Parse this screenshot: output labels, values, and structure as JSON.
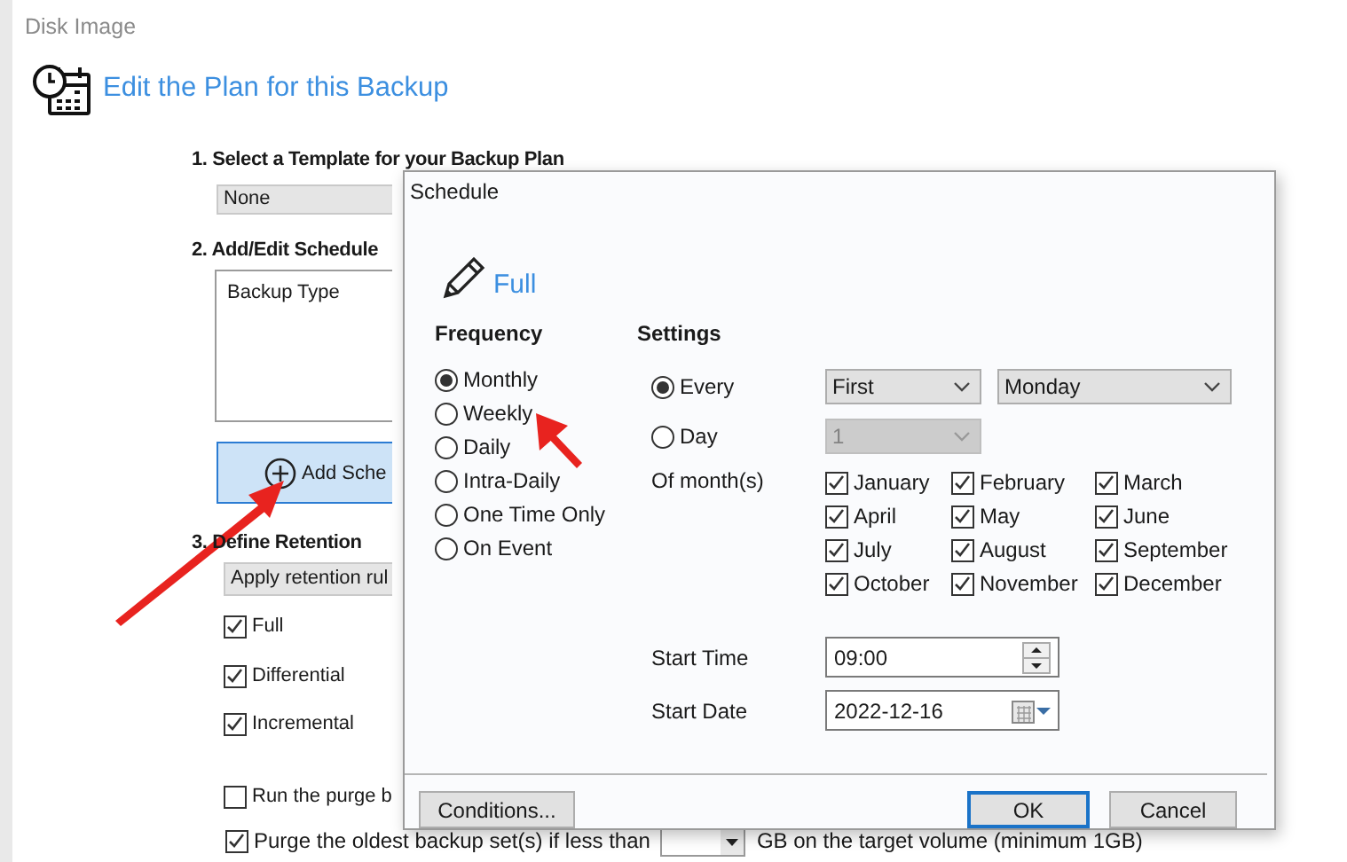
{
  "window": {
    "title": "Disk Image"
  },
  "header": {
    "title": "Edit the Plan for this Backup"
  },
  "plan": {
    "template_heading": "1. Select a Template for your Backup Plan",
    "template_value": "None",
    "schedule_heading": "2. Add/Edit Schedule",
    "schedule_columns": [
      "Backup Type"
    ],
    "add_button": "Add Sche",
    "retention_heading": "3. Define Retention",
    "retention_value": "Apply retention rul",
    "retention_types": [
      {
        "label": "Full",
        "checked": true
      },
      {
        "label": "Differential",
        "checked": true
      },
      {
        "label": "Incremental",
        "checked": true
      }
    ],
    "purge_options": [
      {
        "label": "Run the purge b",
        "checked": false
      },
      {
        "label": "Purge the oldest backup set(s) if less than",
        "checked": true
      }
    ],
    "purge_unit": "GB on the target volume (minimum 1GB)"
  },
  "dialog": {
    "title": "Schedule",
    "backup_type": "Full",
    "frequency": {
      "heading": "Frequency",
      "options": [
        {
          "label": "Monthly",
          "selected": true
        },
        {
          "label": "Weekly",
          "selected": false
        },
        {
          "label": "Daily",
          "selected": false
        },
        {
          "label": "Intra-Daily",
          "selected": false
        },
        {
          "label": "One Time Only",
          "selected": false
        },
        {
          "label": "On Event",
          "selected": false
        }
      ]
    },
    "settings": {
      "heading": "Settings",
      "modes": [
        {
          "label": "Every",
          "selected": true,
          "fields": [
            {
              "value": "First",
              "disabled": false
            },
            {
              "value": "Monday",
              "disabled": false
            }
          ]
        },
        {
          "label": "Day",
          "selected": false,
          "fields": [
            {
              "value": "1",
              "disabled": true
            }
          ]
        }
      ],
      "months_label": "Of month(s)",
      "months": [
        {
          "label": "January",
          "checked": true
        },
        {
          "label": "February",
          "checked": true
        },
        {
          "label": "March",
          "checked": true
        },
        {
          "label": "April",
          "checked": true
        },
        {
          "label": "May",
          "checked": true
        },
        {
          "label": "June",
          "checked": true
        },
        {
          "label": "July",
          "checked": true
        },
        {
          "label": "August",
          "checked": true
        },
        {
          "label": "September",
          "checked": true
        },
        {
          "label": "October",
          "checked": true
        },
        {
          "label": "November",
          "checked": true
        },
        {
          "label": "December",
          "checked": true
        }
      ],
      "start_time": {
        "label": "Start Time",
        "value": "09:00"
      },
      "start_date": {
        "label": "Start Date",
        "value": "2022-12-16"
      }
    },
    "buttons": [
      {
        "label": "Conditions...",
        "default": false
      },
      {
        "label": "OK",
        "default": true
      },
      {
        "label": "Cancel",
        "default": false
      }
    ]
  }
}
